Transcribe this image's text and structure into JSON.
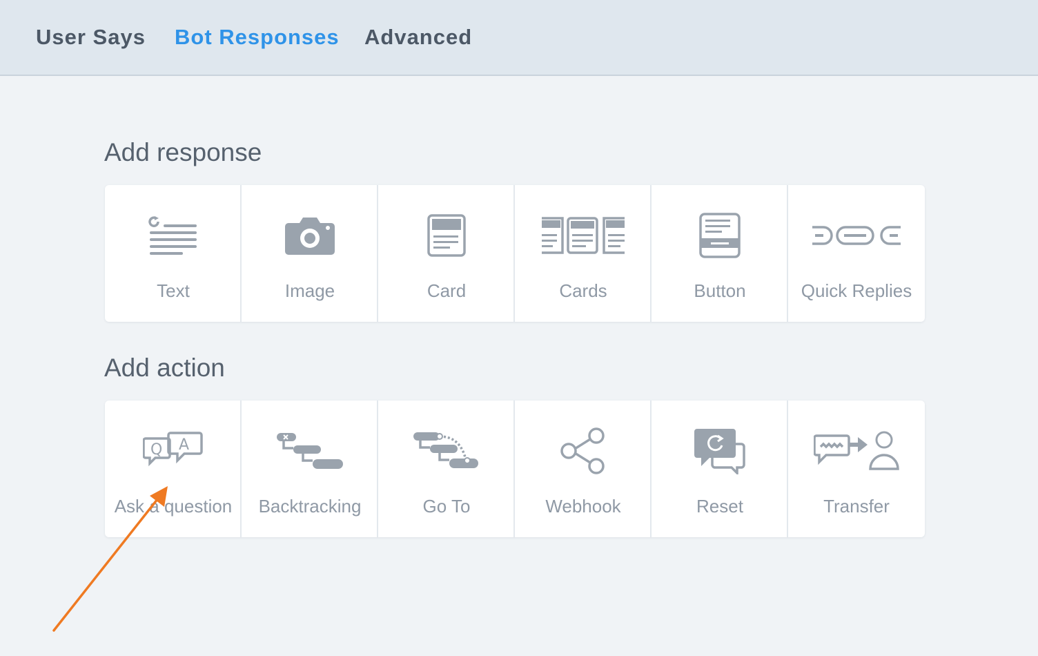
{
  "tabs": [
    {
      "label": "User Says",
      "active": false
    },
    {
      "label": "Bot Responses",
      "active": true
    },
    {
      "label": "Advanced",
      "active": false
    }
  ],
  "responses": {
    "title": "Add response",
    "items": [
      {
        "label": "Text",
        "icon": "text-icon"
      },
      {
        "label": "Image",
        "icon": "camera-icon"
      },
      {
        "label": "Card",
        "icon": "card-icon"
      },
      {
        "label": "Cards",
        "icon": "cards-icon"
      },
      {
        "label": "Button",
        "icon": "button-icon"
      },
      {
        "label": "Quick Replies",
        "icon": "quick-replies-icon"
      }
    ]
  },
  "actions": {
    "title": "Add action",
    "items": [
      {
        "label": "Ask a question",
        "icon": "qa-icon"
      },
      {
        "label": "Backtracking",
        "icon": "backtracking-icon"
      },
      {
        "label": "Go To",
        "icon": "goto-icon"
      },
      {
        "label": "Webhook",
        "icon": "share-icon"
      },
      {
        "label": "Reset",
        "icon": "reset-icon"
      },
      {
        "label": "Transfer",
        "icon": "transfer-icon"
      }
    ]
  },
  "colors": {
    "accent": "#2f93e8",
    "tab_text": "#4c5866",
    "icon": "#9aa3ad",
    "annotation_arrow": "#ef7a22"
  }
}
